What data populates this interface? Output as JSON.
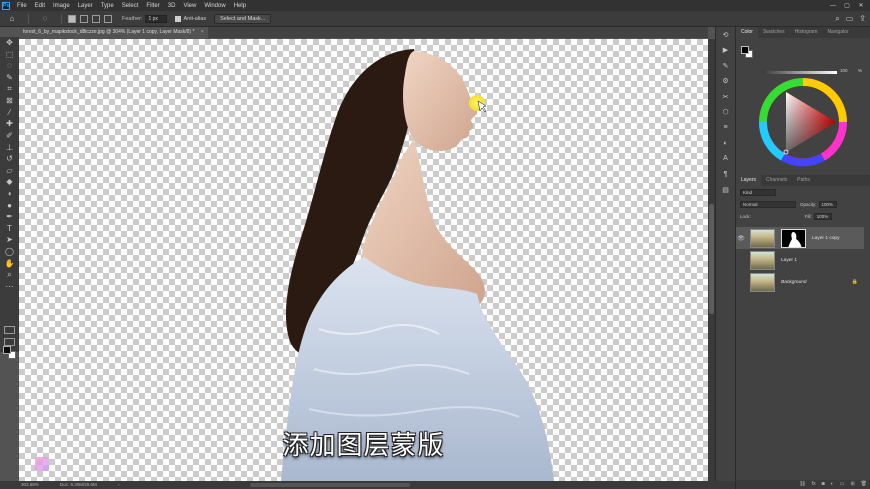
{
  "menu": [
    "File",
    "Edit",
    "Image",
    "Layer",
    "Type",
    "Select",
    "Filter",
    "3D",
    "View",
    "Window",
    "Help"
  ],
  "window_controls": [
    "—",
    "▢",
    "✕"
  ],
  "options_bar": {
    "feather_label": "Feather:",
    "feather_value": "1 px",
    "anti_alias_label": "Anti-alias",
    "select_mask_label": "Select and Mask..."
  },
  "document": {
    "tab_title": "forest_6_by_mapikstock_d8iczze.jpg @ 304% (Layer 1 copy, Layer Mask/8) *",
    "tab_close": "×",
    "subtitle": "添加图层蒙版"
  },
  "status": {
    "zoom": "303.68%",
    "doc_size": "Doc: 9.30M/29.6M",
    "arrow": "›"
  },
  "panels": {
    "color_tabs": [
      "Color",
      "Swatches",
      "Histogram",
      "Navigator"
    ],
    "color_active_tab": 0,
    "slider_value": "100",
    "slider_unit": "%",
    "layer_tabs": [
      "Layers",
      "Channels",
      "Paths"
    ],
    "layers_active_tab": 0,
    "kind_label": "Kind",
    "blend_mode": "Normal",
    "opacity_label": "Opacity:",
    "opacity_value": "100%",
    "lock_label": "Lock:",
    "fill_label": "Fill:",
    "fill_value": "100%",
    "layers": [
      {
        "name": "Layer 1 copy",
        "visible": true,
        "selected": true,
        "has_mask": true,
        "italic": false,
        "locked": false
      },
      {
        "name": "Layer 1",
        "visible": false,
        "selected": false,
        "has_mask": false,
        "italic": false,
        "locked": false
      },
      {
        "name": "Background",
        "visible": false,
        "selected": false,
        "has_mask": false,
        "italic": true,
        "locked": true
      }
    ]
  },
  "colors": {
    "accent": "#31a8ff",
    "canvas_checker": "#cccccc",
    "cursor_highlight": "#f2e030"
  }
}
